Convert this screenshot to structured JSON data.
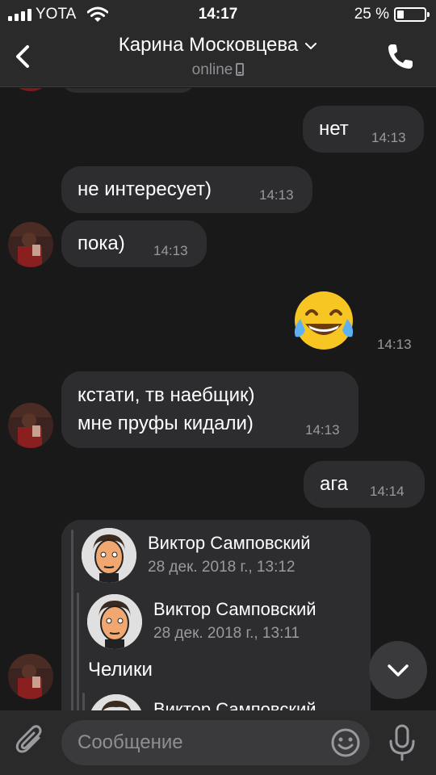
{
  "status_bar": {
    "carrier": "YOTA",
    "time": "14:17",
    "battery_text": "25 %",
    "battery_level": 0.25,
    "icons": [
      "signal-icon",
      "wifi-icon",
      "battery-icon"
    ]
  },
  "header": {
    "title": "Карина Московцева",
    "subtitle": "online",
    "icons": [
      "back-chevron-icon",
      "chevron-down-icon",
      "mobile-phone-icon",
      "call-icon"
    ]
  },
  "messages": [
    {
      "side": "out",
      "text": "нет",
      "time": "14:13"
    },
    {
      "side": "in",
      "text": "не интересует)",
      "time": "14:13"
    },
    {
      "side": "in",
      "text": "пока)",
      "time": "14:13"
    },
    {
      "side": "out",
      "emoji": "😂",
      "time": "14:13"
    },
    {
      "side": "in",
      "lines": [
        "кстати, тв наебщик)",
        "мне пруфы кидали)"
      ],
      "time": "14:13"
    },
    {
      "side": "out",
      "text": "ага",
      "time": "14:14"
    }
  ],
  "forwarded": {
    "outer": {
      "name": "Виктор Самповский",
      "date": "28 дек. 2018 г., 13:12"
    },
    "inner": {
      "name": "Виктор Самповский",
      "date": "28 дек. 2018 г., 13:11",
      "text": "Челики"
    },
    "next": {
      "name": "Виктор Самповский"
    }
  },
  "composer": {
    "placeholder": "Сообщение",
    "icons": [
      "paperclip-icon",
      "emoji-icon",
      "microphone-icon"
    ]
  },
  "scroll_button": {
    "icon": "chevron-down-icon"
  },
  "colors": {
    "background": "#19191a",
    "bars": "#2a2a2b",
    "bubble": "#2d2d2f",
    "secondary_text": "#9a9a9e"
  }
}
